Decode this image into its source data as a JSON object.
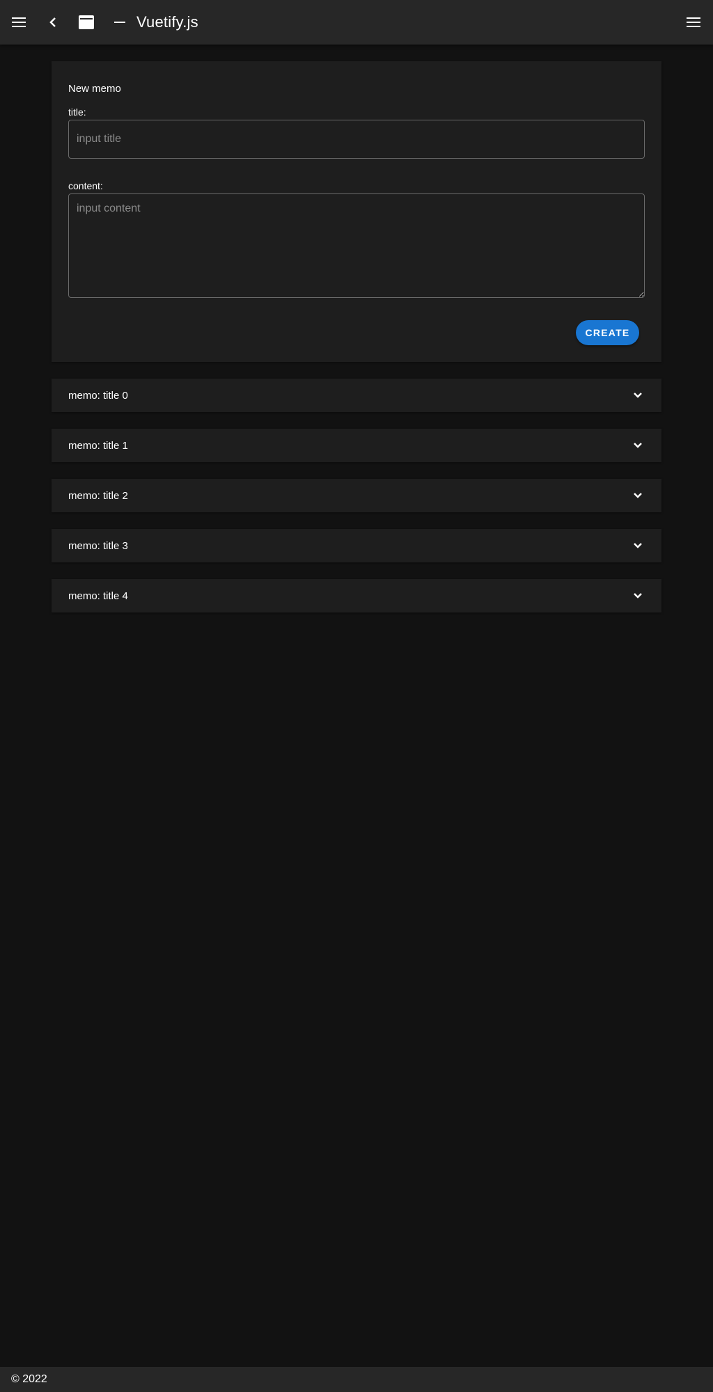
{
  "app_bar": {
    "title": "Vuetify.js",
    "icons": [
      "menu-icon",
      "chevron-left-icon",
      "web-asset-icon",
      "minus-icon",
      "menu-icon"
    ]
  },
  "new_memo": {
    "heading": "New memo",
    "title_label": "title:",
    "title_value": "",
    "title_placeholder": "input title",
    "content_label": "content:",
    "content_value": "",
    "content_placeholder": "input content",
    "create_label": "CREATE"
  },
  "memos": [
    {
      "label": "memo: title 0"
    },
    {
      "label": "memo: title 1"
    },
    {
      "label": "memo: title 2"
    },
    {
      "label": "memo: title 3"
    },
    {
      "label": "memo: title 4"
    }
  ],
  "footer": {
    "text": "© 2022"
  },
  "colors": {
    "background": "#121212",
    "surface": "#1e1e1e",
    "app_bar": "#272727",
    "primary": "#1976d2"
  }
}
